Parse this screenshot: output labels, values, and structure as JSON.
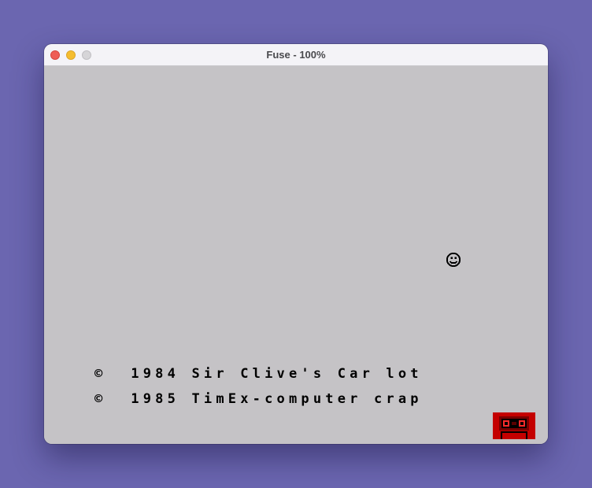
{
  "window": {
    "title": "Fuse - 100%"
  },
  "screen": {
    "lines": [
      "©  1984 Sir Clive's Car lot",
      "©  1985 TimEx-computer crap"
    ]
  },
  "status": {
    "tape_icon": "cassette-tape-icon",
    "tape_color": "#c40000"
  },
  "colors": {
    "background": "#6b66b0",
    "screen": "#c5c3c6",
    "ink": "#000000"
  }
}
